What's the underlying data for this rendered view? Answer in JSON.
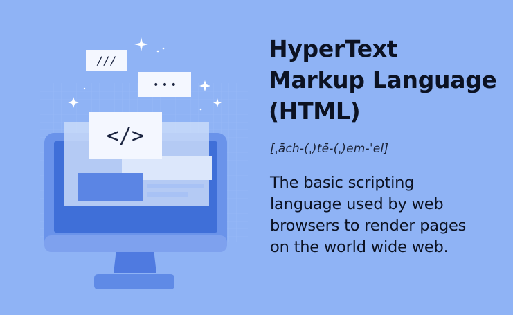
{
  "illustration": {
    "bubble_slash": "///",
    "bubble_dots": "• • •",
    "tag_symbol": "</>"
  },
  "heading": {
    "lines": [
      "HyperText",
      "Markup Language",
      "(HTML)"
    ]
  },
  "pronunciation": "[ˌāch-(ˌ)tē-(ˌ)em-ˈel]",
  "description": {
    "lines": [
      "The basic scripting",
      "language used by web",
      "browsers to render pages",
      "on the world wide web."
    ]
  },
  "colors": {
    "background": "#8fb3f5",
    "monitor_frame": "#5f8ae6",
    "screen": "#3f6fd8",
    "card_light": "#f4f7ff",
    "text": "#0c1222"
  }
}
